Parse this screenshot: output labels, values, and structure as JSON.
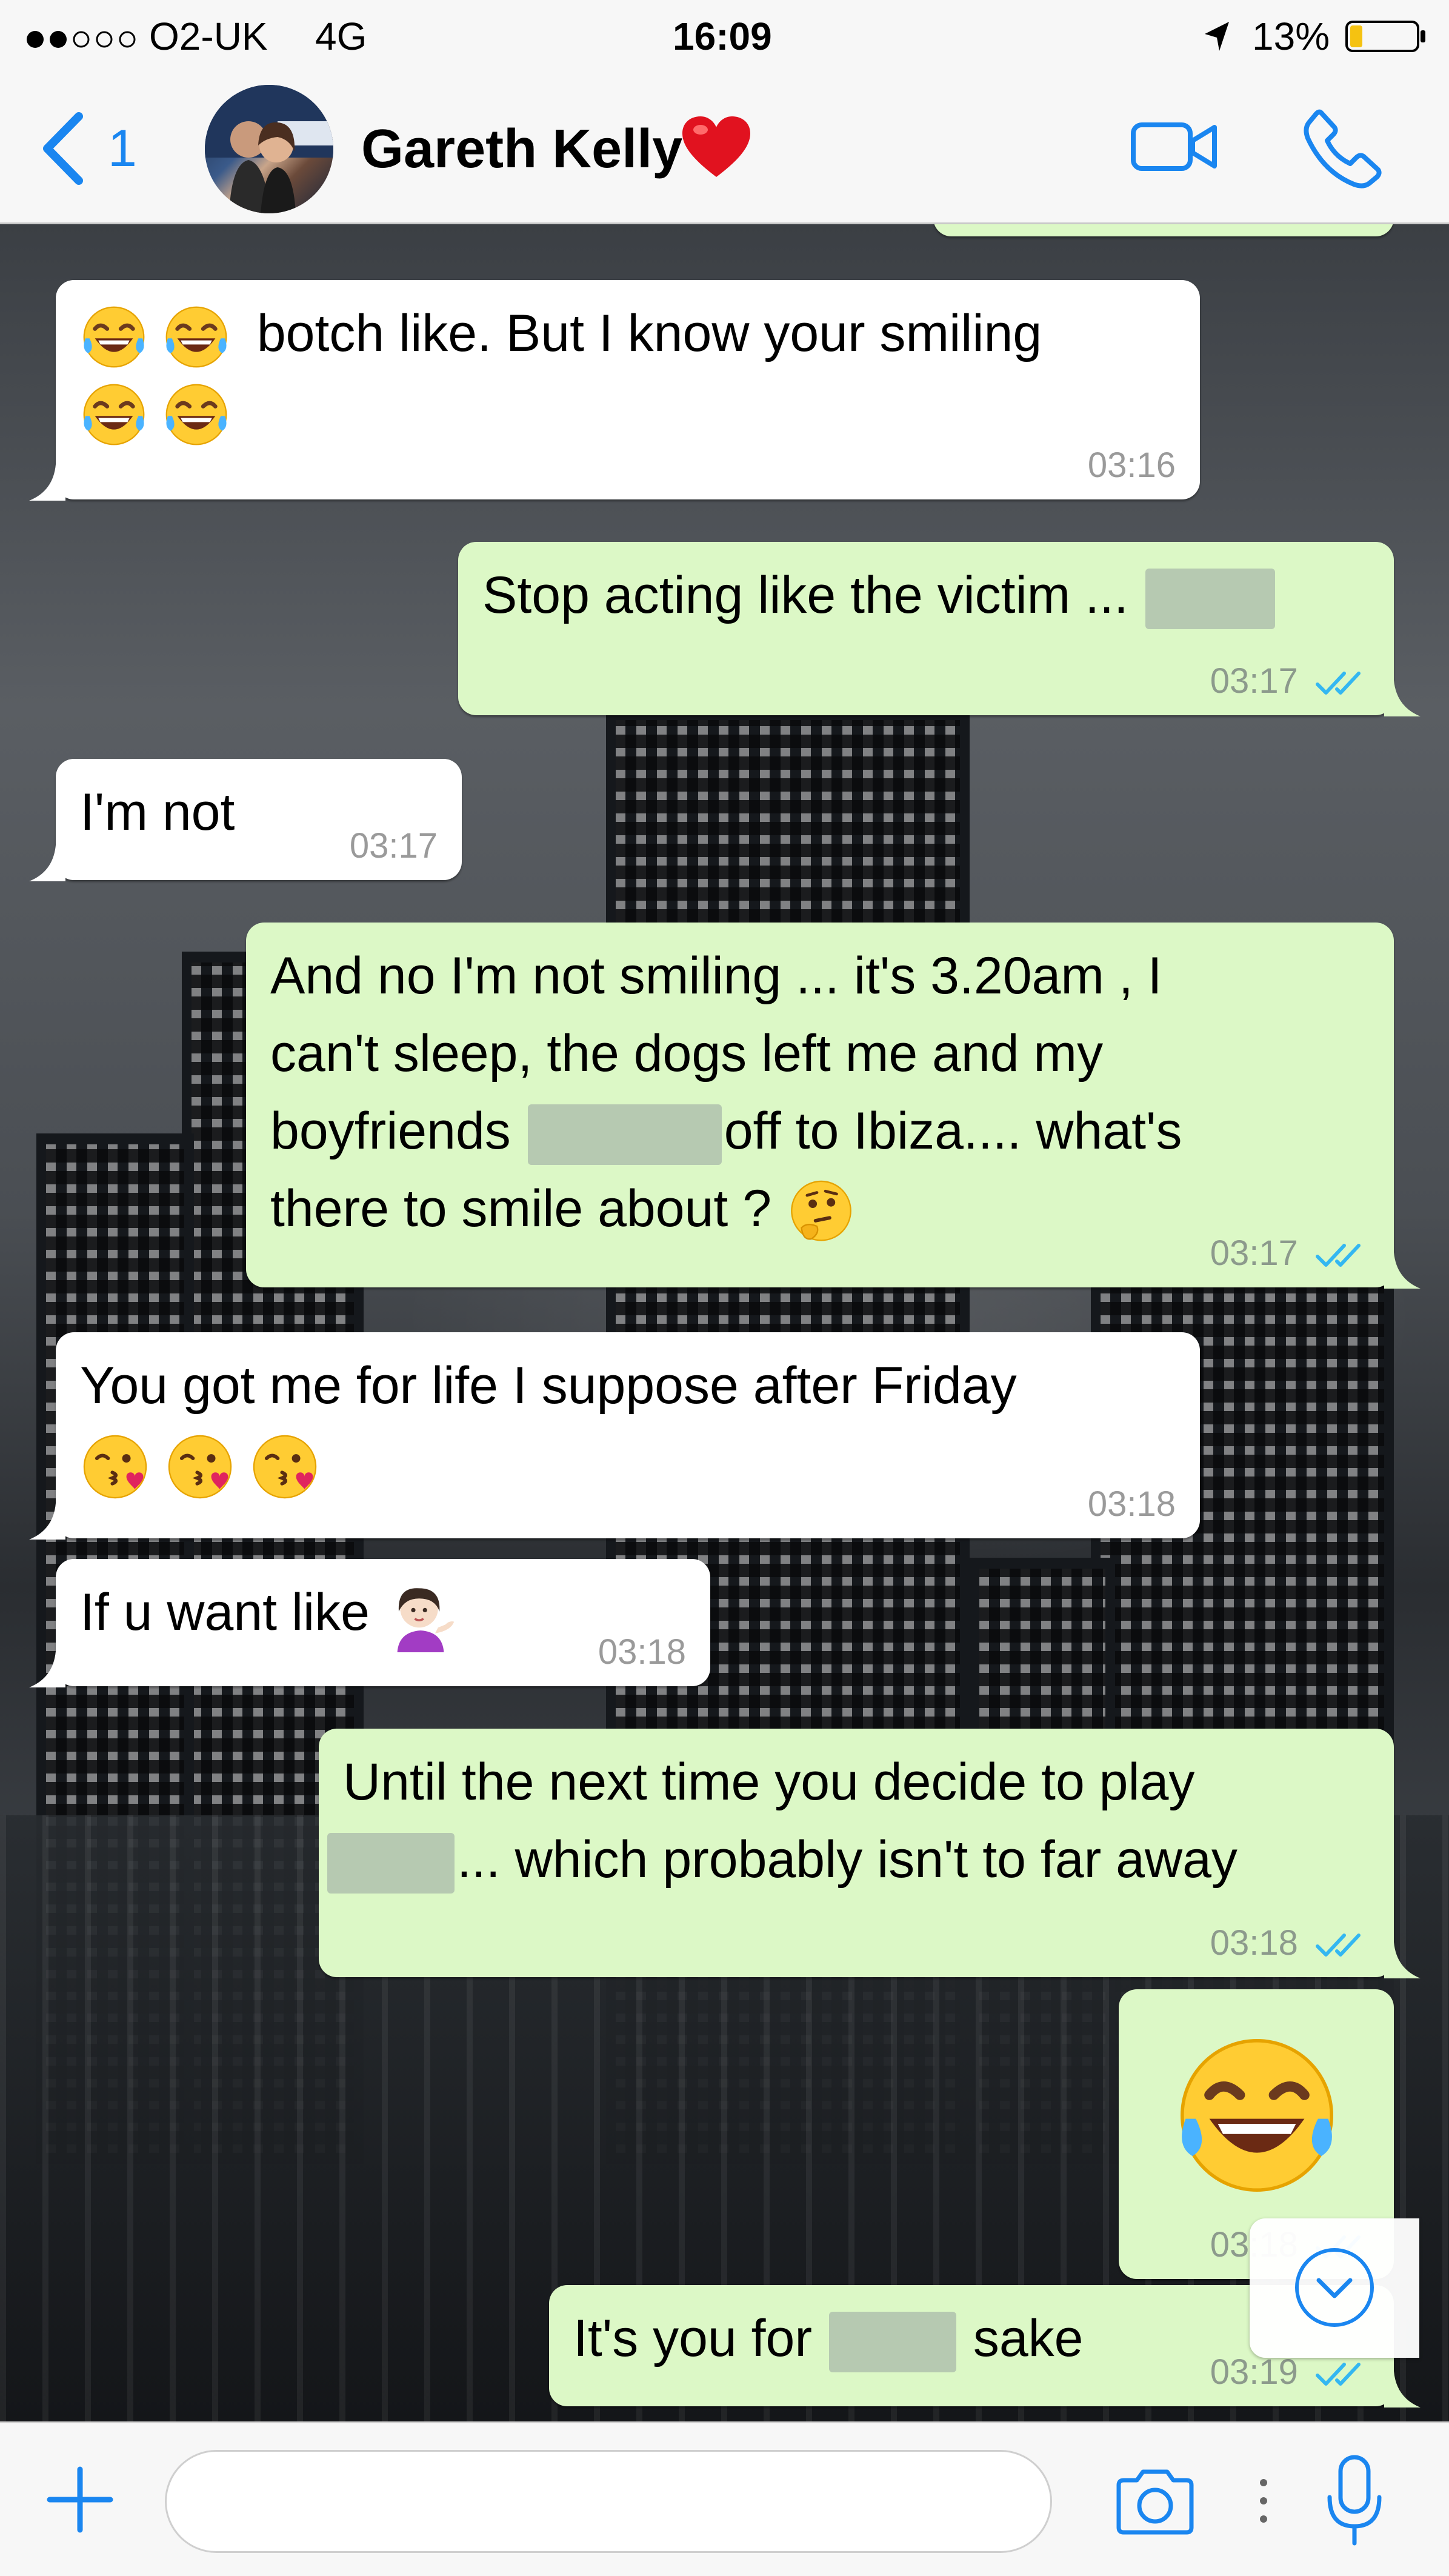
{
  "status_bar": {
    "carrier": "O2-UK",
    "network": "4G",
    "time": "16:09",
    "battery": "13%",
    "icons": [
      "signal-dots-icon",
      "location-arrow-icon",
      "battery-icon"
    ]
  },
  "nav": {
    "back_count": "1",
    "contact_name": "Gareth Kelly",
    "icons": [
      "chevron-left-icon",
      "heart-icon",
      "video-call-icon",
      "phone-icon"
    ]
  },
  "messages": [
    {
      "dir": "in",
      "text": "botch like. But I know your smiling",
      "time": "03:16"
    },
    {
      "dir": "out",
      "text_before": "Stop acting like the victim ...",
      "time": "03:17",
      "status": "read"
    },
    {
      "dir": "in",
      "text": "I'm not",
      "time": "03:17"
    },
    {
      "dir": "out",
      "line1": "And no I'm not smiling ... it's 3.20am , I",
      "line2": "can't sleep, the dogs left me and my",
      "line3_before": "boyfriends",
      "line3_after": "off to Ibiza.... what's",
      "line4": "there to smile about ?",
      "time": "03:17",
      "status": "read"
    },
    {
      "dir": "in",
      "text": "You got me for life I suppose after Friday",
      "time": "03:18"
    },
    {
      "dir": "in",
      "text": "If u want like",
      "time": "03:18"
    },
    {
      "dir": "out",
      "line1": "Until the next time you decide to play",
      "line2_after": "... which probably isn't to far away",
      "time": "03:18",
      "status": "read"
    },
    {
      "dir": "out",
      "text": "",
      "time": "03:18",
      "status": "read"
    },
    {
      "dir": "out",
      "text_before": "It's you for",
      "text_after": "sake",
      "time": "03:19",
      "status": "read"
    }
  ],
  "emojis": [
    "laughing-tears",
    "thinking-face",
    "kissing-heart",
    "woman-tipping-hand"
  ],
  "input_bar": {
    "placeholder": "",
    "icons": [
      "plus-icon",
      "camera-icon",
      "mic-icon",
      "scroll-down-icon"
    ]
  },
  "colors": {
    "incoming_bubble": "#ffffff",
    "outgoing_bubble": "#dcf8c6",
    "accent_blue": "#1a86f0",
    "read_ticks": "#34b7f1"
  }
}
